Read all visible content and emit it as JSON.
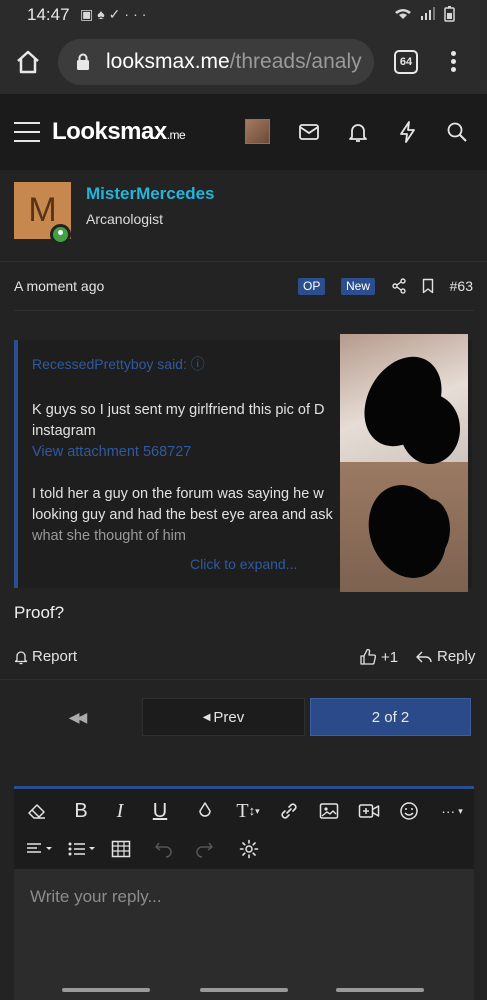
{
  "status_bar": {
    "time": "14:47",
    "left_icons": [
      "image-icon",
      "snapchat-icon",
      "download-done-icon",
      "more-dots-icon"
    ],
    "right_icons": [
      "wifi-icon",
      "signal-icon",
      "battery-icon"
    ]
  },
  "browser": {
    "url_domain": "looksmax.me",
    "url_path": "/threads/analy",
    "tab_count": "64"
  },
  "site": {
    "logo_main": "Looksmax",
    "logo_tld": ".me"
  },
  "post": {
    "username": "MisterMercedes",
    "user_title": "Arcanologist",
    "avatar_letter": "M",
    "time": "A moment ago",
    "badge_op": "OP",
    "badge_new": "New",
    "post_number": "#63",
    "quote": {
      "header": "RecessedPrettyboy said: ",
      "lines": [
        "K guys so I just sent my girlfriend this pic of D",
        "instagram"
      ],
      "attachment": "View attachment 568727",
      "lines2": [
        "I told her a guy on the forum was saying he w",
        "looking guy and had the best eye area and ask"
      ],
      "faded_line": "what she thought of him",
      "expand": "Click to expand..."
    },
    "body": "Proof?",
    "actions": {
      "report": "Report",
      "like_count": "+1",
      "reply": "Reply"
    }
  },
  "pagination": {
    "prev": "Prev",
    "current": "2 of 2"
  },
  "editor": {
    "placeholder": "Write your reply..."
  },
  "colors": {
    "accent": "#2b4f8e",
    "username": "#22b5d8",
    "online": "#43a047",
    "background": "#232323"
  }
}
